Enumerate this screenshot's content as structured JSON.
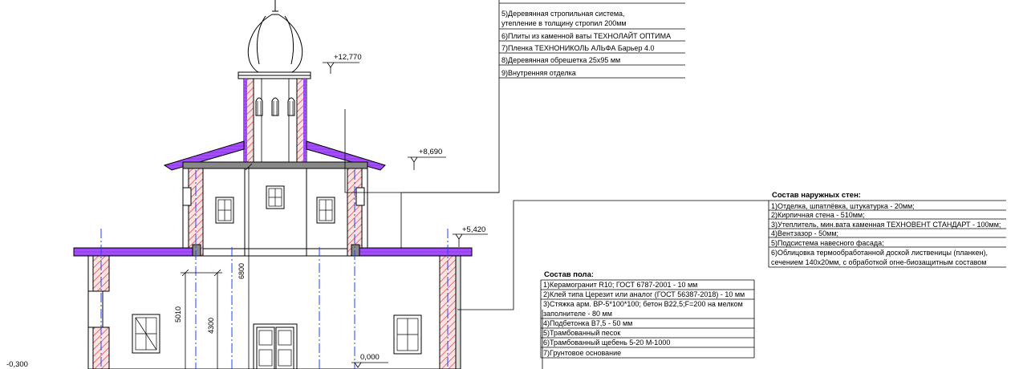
{
  "roof_spec": {
    "rows": [
      "5)Деревянная стропильная система,",
      " утепление в толщину стропил 200мм",
      "6)Плиты из каменной ваты ТЕХНОЛАЙТ ОПТИМА",
      "7)Пленка ТЕХНОНИКОЛЬ АЛЬФА Барьер 4.0",
      "8)Деревянная обрешетка 25х95 мм",
      "9)Внутренняя отделка"
    ]
  },
  "walls_spec": {
    "title": "Состав наружных стен:",
    "rows": [
      "1)Отделка, шпатлёвка, штукатурка - 20мм;",
      "2)Кирпичная стена - 510мм;",
      "3)Утеплитель, мин.вата каменная ТЕХНОВЕНТ СТАНДАРТ - 100мм;",
      "4)Вентзазор - 50мм;",
      "5)Подсистема навесного фасада;",
      "6)Облицовка термообработанной доской лиственицы (планкен),",
      "сечением 140х20мм, с обработкой огне-биозащитным составом"
    ]
  },
  "floor_spec": {
    "title": "Состав пола:",
    "rows": [
      "1)Керамогранит R10; ГОСТ 6787-2001 - 10 мм",
      "2)Клей типа Церезит  или аналог (ГОСТ 56387-2018) - 10 мм",
      "3)Стяжка арм. ВР-5*100*100; бетон В22,5;F=200 на мелком",
      "заполнителе - 80 мм",
      "4)Подбетонка В7,5 - 50 мм",
      "5)Трамбованный песок",
      "6)Трамбованный щебень 5-20 М-1000",
      "7)Грунтовое основание"
    ]
  },
  "elevations": {
    "e1": "+12,770",
    "e2": "+8,690",
    "e3": "+5,420",
    "e4": "0,000",
    "e5": "-0,300"
  },
  "dimensions": {
    "d1": "6800",
    "d2": "5010",
    "d3": "4300"
  },
  "colors": {
    "roof": "#a64dff",
    "insulation_hatch": "#e05050",
    "axis": "#2040ff",
    "line": "#000000"
  }
}
